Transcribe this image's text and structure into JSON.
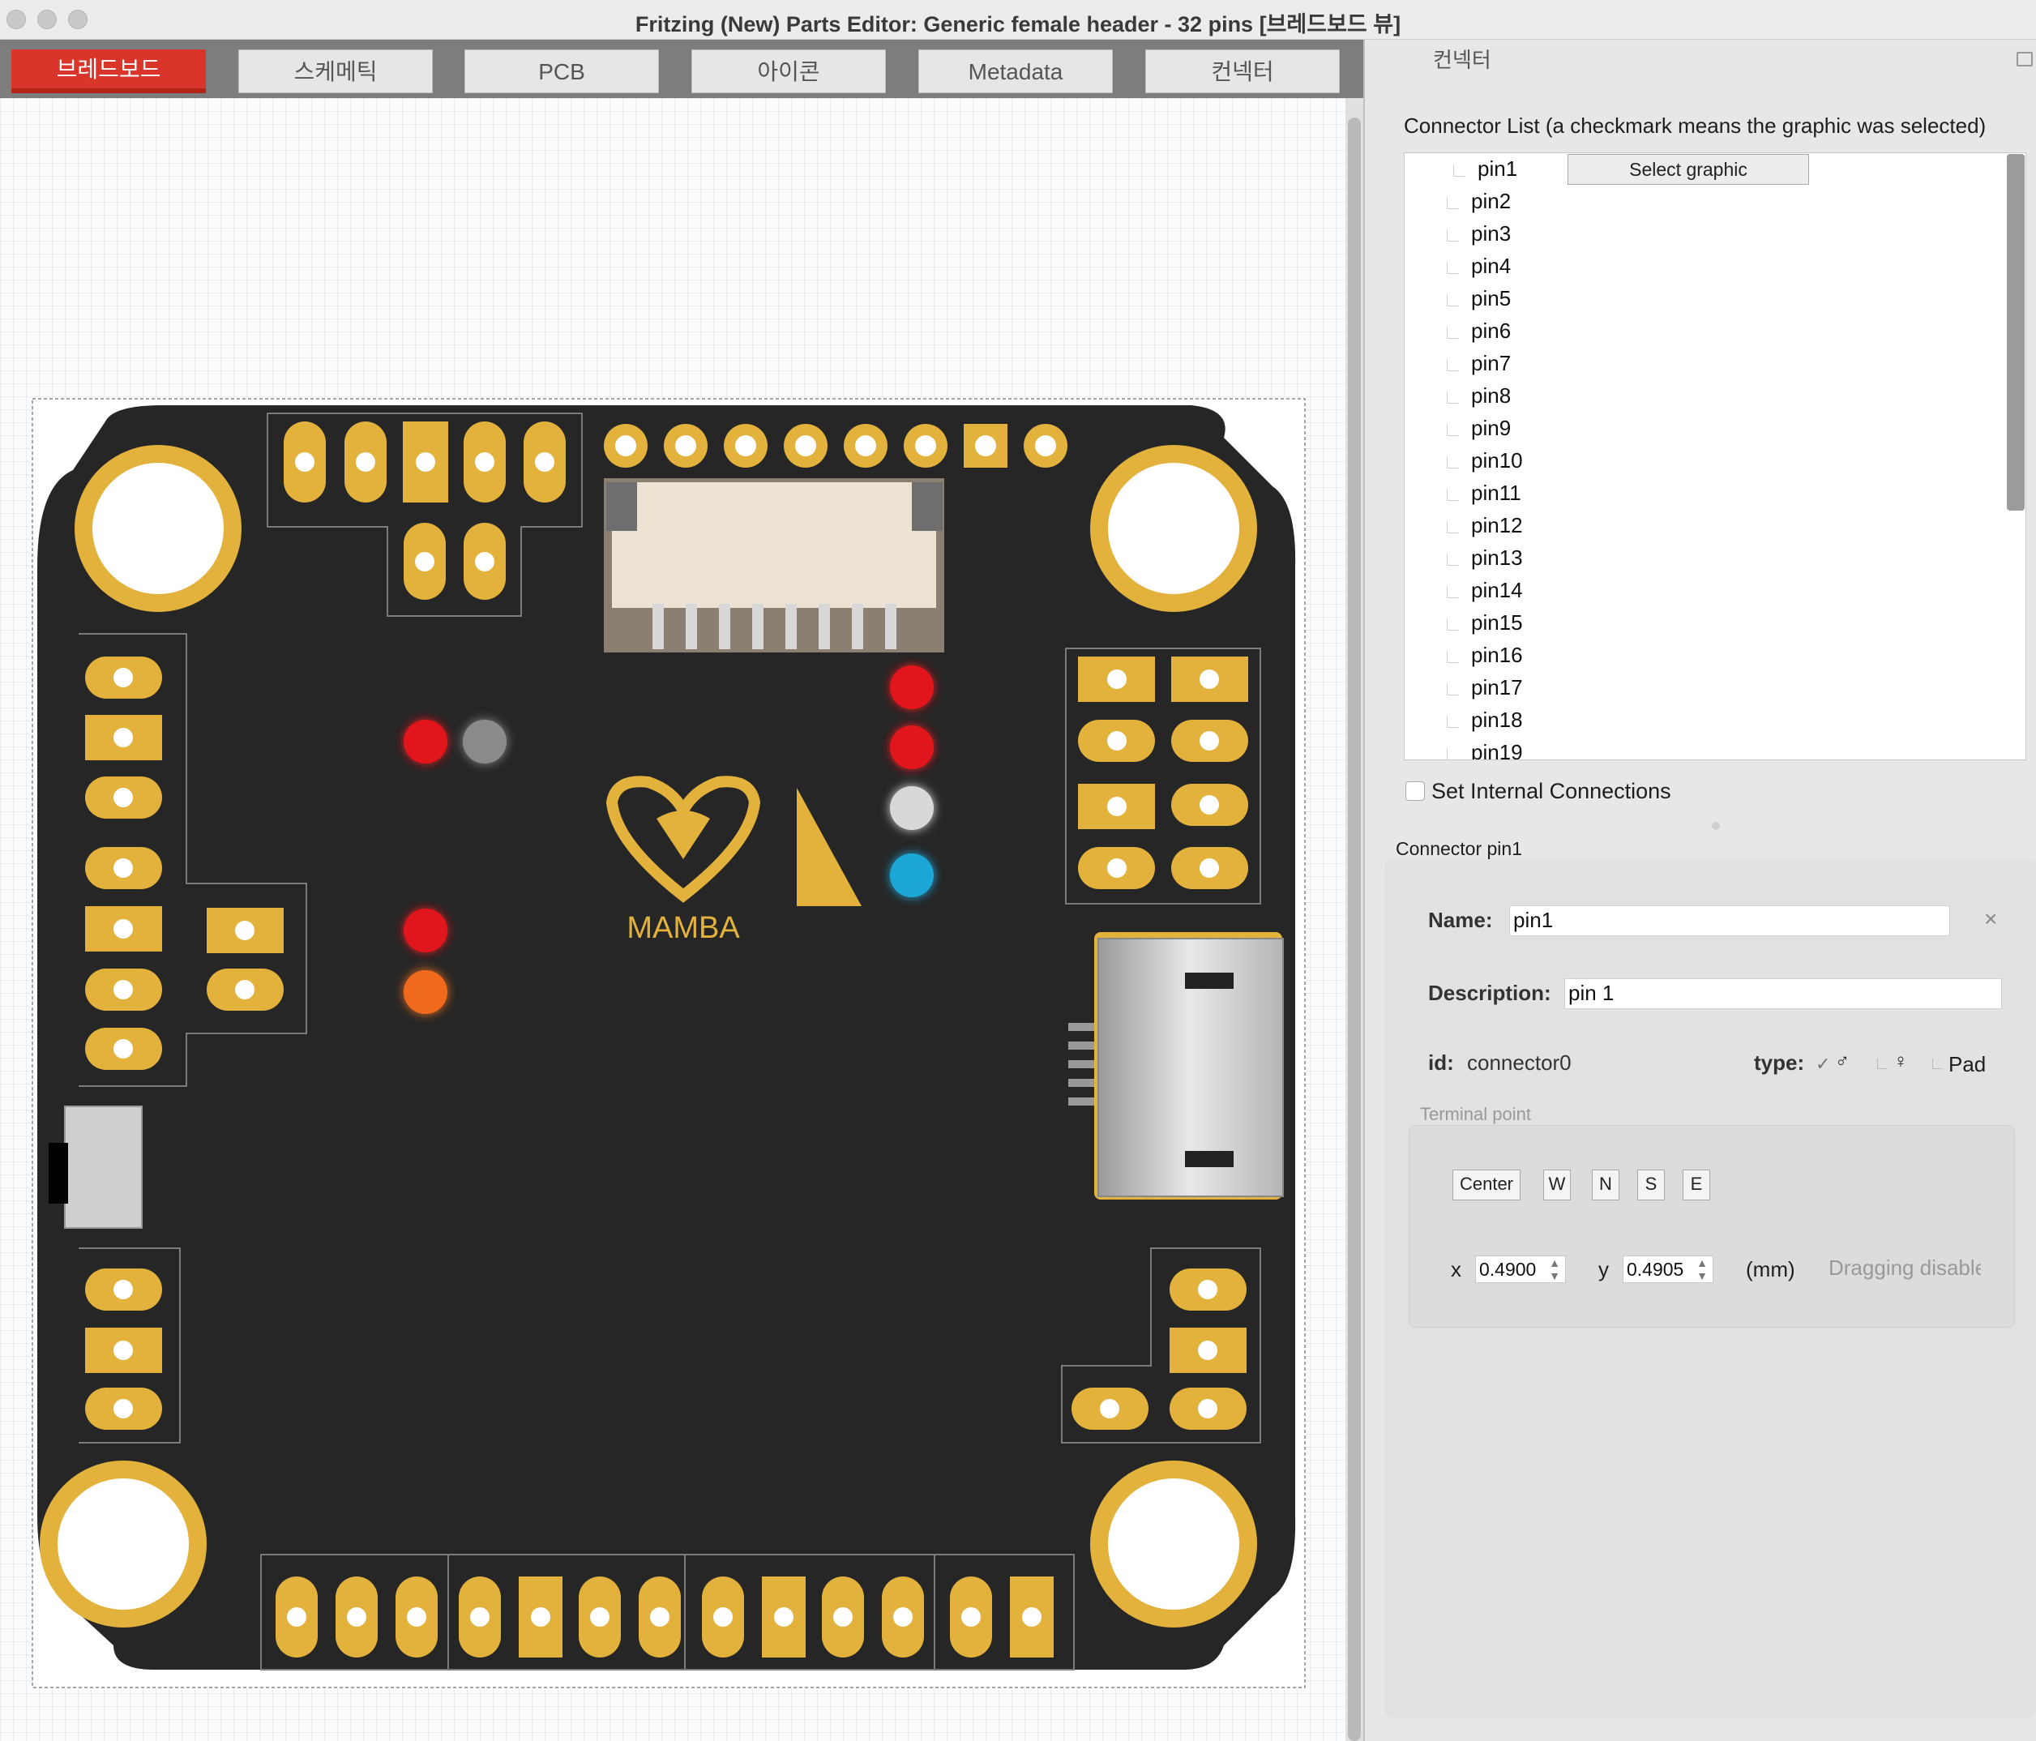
{
  "window": {
    "title": "Fritzing (New) Parts Editor: Generic female header - 32 pins [브레드보드 뷰]"
  },
  "tabs": [
    {
      "label": "브레드보드",
      "active": true
    },
    {
      "label": "스케메틱",
      "active": false
    },
    {
      "label": "PCB",
      "active": false
    },
    {
      "label": "아이콘",
      "active": false
    },
    {
      "label": "Metadata",
      "active": false
    },
    {
      "label": "컨넥터",
      "active": false
    }
  ],
  "board": {
    "logo_text": "MAMBA",
    "led_colors": [
      "#e0191f",
      "#8a8a8a",
      "#e0191f",
      "#e0191f",
      "#d8d8d8",
      "#1ea6d6",
      "#e0191f",
      "#ef6a1c"
    ]
  },
  "panel": {
    "title": "컨넥터",
    "connector_list_label": "Connector List (a checkmark means the graphic was selected)",
    "select_graphic_button": "Select graphic",
    "pins": [
      "pin1",
      "pin2",
      "pin3",
      "pin4",
      "pin5",
      "pin6",
      "pin7",
      "pin8",
      "pin9",
      "pin10",
      "pin11",
      "pin12",
      "pin13",
      "pin14",
      "pin15",
      "pin16",
      "pin17",
      "pin18",
      "pin19"
    ],
    "internal_connections_label": "Set Internal Connections",
    "connector_header": "Connector pin1",
    "name_label": "Name:",
    "name_value": "pin1",
    "description_label": "Description:",
    "description_value": "pin 1",
    "id_label": "id:",
    "id_value": "connector0",
    "type_label": "type:",
    "type_options": {
      "male": "♂",
      "female": "♀",
      "pad": "Pad"
    },
    "terminal_label": "Terminal point",
    "terminal_buttons": [
      "Center",
      "W",
      "N",
      "S",
      "E"
    ],
    "x_label": "x",
    "x_value": "0.4900",
    "y_label": "y",
    "y_value": "0.4905",
    "units": "(mm)",
    "dragging_text": "Dragging disable"
  }
}
